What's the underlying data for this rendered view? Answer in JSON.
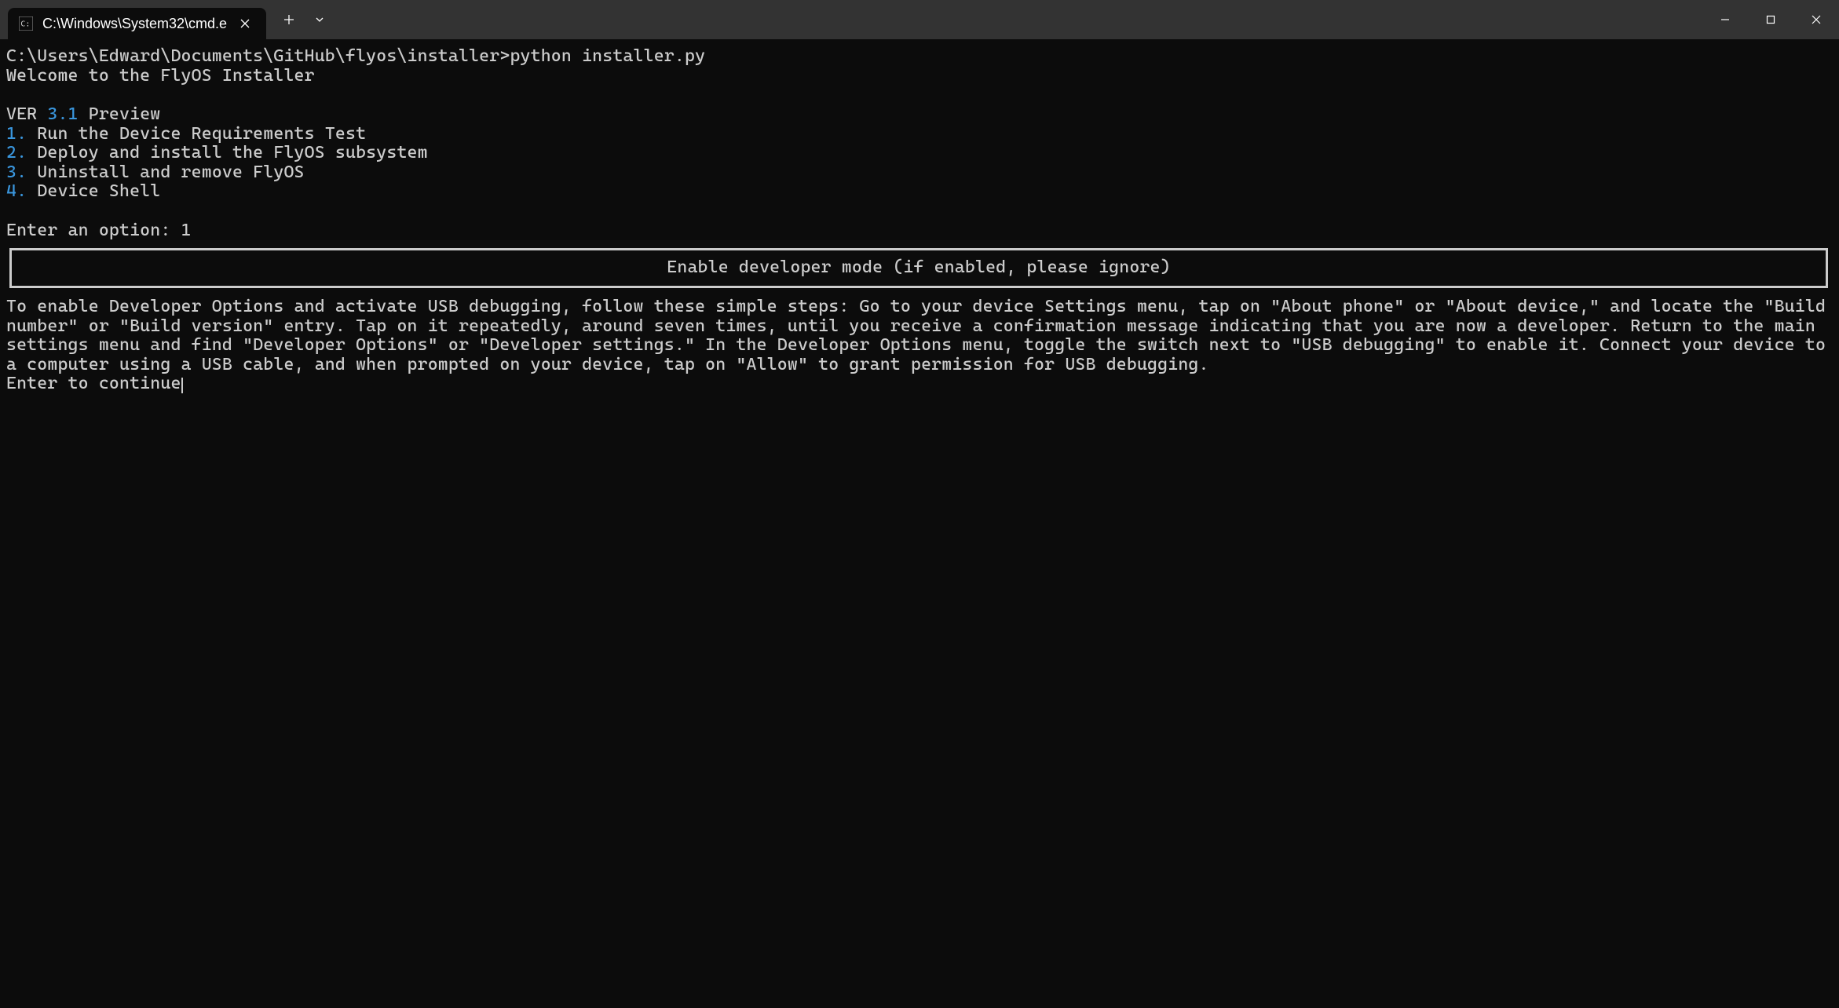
{
  "titlebar": {
    "tab_title": "C:\\Windows\\System32\\cmd.e"
  },
  "terminal": {
    "prompt_line": "C:\\Users\\Edward\\Documents\\GitHub\\flyos\\installer>python installer.py",
    "welcome": "Welcome to the FlyOS Installer",
    "ver_prefix": "VER ",
    "ver_number": "3.1",
    "ver_suffix": " Preview",
    "menu": [
      {
        "num": "1.",
        "label": " Run the Device Requirements Test"
      },
      {
        "num": "2.",
        "label": " Deploy and install the FlyOS subsystem"
      },
      {
        "num": "3.",
        "label": " Uninstall and remove FlyOS"
      },
      {
        "num": "4.",
        "label": " Device Shell"
      }
    ],
    "enter_option": "Enter an option: 1",
    "boxed_msg": "Enable developer mode (if enabled, please ignore)",
    "instructions": "To enable Developer Options and activate USB debugging, follow these simple steps: Go to your device Settings menu, tap on \"About phone\" or \"About device,\" and locate the \"Build number\" or \"Build version\" entry. Tap on it repeatedly, around seven times, until you receive a confirmation message indicating that you are now a developer. Return to the main settings menu and find \"Developer Options\" or \"Developer settings.\" In the Developer Options menu, toggle the switch next to \"USB debugging\" to enable it. Connect your device to a computer using a USB cable, and when prompted on your device, tap on \"Allow\" to grant permission for USB debugging.",
    "continue_prompt": "Enter to continue"
  }
}
